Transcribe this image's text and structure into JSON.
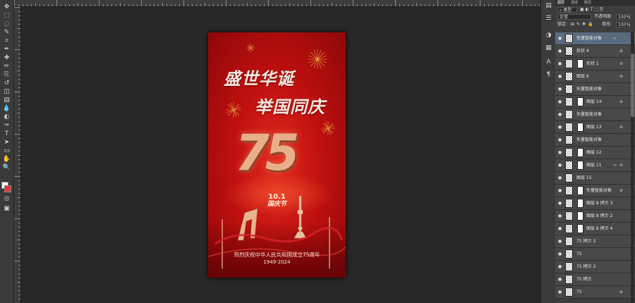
{
  "toolbar": {
    "tools": [
      "move-icon",
      "marquee-icon",
      "lasso-icon",
      "quick-select-icon",
      "crop-icon",
      "eyedropper-icon",
      "healing-icon",
      "brush-icon",
      "clone-stamp-icon",
      "history-brush-icon",
      "eraser-icon",
      "gradient-icon",
      "blur-icon",
      "dodge-icon",
      "pen-icon",
      "type-icon",
      "path-select-icon",
      "rectangle-icon",
      "hand-icon",
      "zoom-icon"
    ],
    "glyphs": [
      "✥",
      "⬚",
      "◌",
      "✎",
      "⌗",
      "✒",
      "✚",
      "✏",
      "⎘",
      "↺",
      "◫",
      "▤",
      "💧",
      "◐",
      "✑",
      "T",
      "➤",
      "▭",
      "✋",
      "🔍"
    ],
    "foreground_color": "#ffffff",
    "background_color": "#d63a3a"
  },
  "poster": {
    "headline_line1": "盛世华诞",
    "headline_line2": "举国同庆",
    "number": "75",
    "badge_line1": "10.1",
    "badge_line2": "国庆节",
    "tagline": "热烈庆祝中华人民共和国成立75周年",
    "years": "1949-2024",
    "accent_color": "#c0100f"
  },
  "layers_panel": {
    "tabs": [
      "图层",
      "通道",
      "路径"
    ],
    "filter_label": "类型",
    "blend_mode": "正常",
    "opacity_label": "不透明度:",
    "opacity_value": "100%",
    "lock_label": "锁定:",
    "fill_label": "填充:",
    "fill_value": "100%",
    "layers": [
      {
        "name": "矢量智能对象",
        "selected": true,
        "mask": false,
        "linked": true,
        "locked": false
      },
      {
        "name": "形状 4",
        "selected": false,
        "mask": false,
        "linked": false,
        "locked": true
      },
      {
        "name": "形状 1",
        "selected": false,
        "mask": true,
        "linked": false,
        "locked": true
      },
      {
        "name": "图层 6",
        "selected": false,
        "mask": false,
        "linked": false,
        "locked": true
      },
      {
        "name": "矢量智能对象",
        "selected": false,
        "mask": false,
        "linked": false,
        "locked": false
      },
      {
        "name": "图层 14",
        "selected": false,
        "mask": true,
        "linked": false,
        "locked": true
      },
      {
        "name": "矢量智能对象",
        "selected": false,
        "mask": false,
        "linked": false,
        "locked": false
      },
      {
        "name": "图层 13",
        "selected": false,
        "mask": true,
        "linked": false,
        "locked": true
      },
      {
        "name": "矢量智能对象",
        "selected": false,
        "mask": false,
        "linked": false,
        "locked": false
      },
      {
        "name": "图层 12",
        "selected": false,
        "mask": true,
        "linked": false,
        "locked": false
      },
      {
        "name": "图层 11",
        "selected": false,
        "mask": true,
        "linked": true,
        "locked": true
      },
      {
        "name": "图层 15",
        "selected": false,
        "mask": false,
        "linked": false,
        "locked": false
      },
      {
        "name": "矢量智能对象",
        "selected": false,
        "mask": true,
        "linked": false,
        "locked": true
      },
      {
        "name": "图层 8 拷贝 3",
        "selected": false,
        "mask": true,
        "linked": false,
        "locked": false
      },
      {
        "name": "图层 8 拷贝 2",
        "selected": false,
        "mask": true,
        "linked": false,
        "locked": false
      },
      {
        "name": "图层 8 拷贝 4",
        "selected": false,
        "mask": true,
        "linked": false,
        "locked": false
      },
      {
        "name": "75 拷贝 3",
        "selected": false,
        "mask": false,
        "linked": false,
        "locked": false
      },
      {
        "name": "75",
        "selected": false,
        "mask": false,
        "linked": false,
        "locked": false
      },
      {
        "name": "75 拷贝 2",
        "selected": false,
        "mask": false,
        "linked": false,
        "locked": false
      },
      {
        "name": "75 拷贝",
        "selected": false,
        "mask": false,
        "linked": false,
        "locked": false
      },
      {
        "name": "75",
        "selected": false,
        "mask": false,
        "linked": false,
        "locked": true
      }
    ]
  }
}
